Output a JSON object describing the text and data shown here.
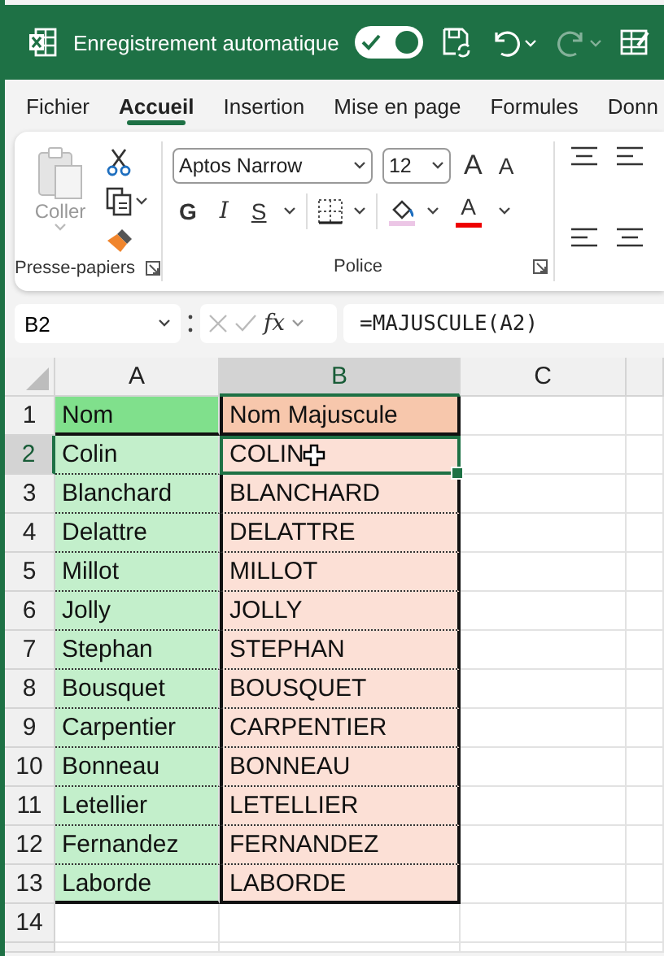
{
  "title_bar": {
    "title": "Enregistrement automatique",
    "autosave_on": true,
    "redo_disabled": true
  },
  "tabs": [
    {
      "label": "Fichier",
      "selected": false
    },
    {
      "label": "Accueil",
      "selected": true
    },
    {
      "label": "Insertion",
      "selected": false
    },
    {
      "label": "Mise en page",
      "selected": false
    },
    {
      "label": "Formules",
      "selected": false
    },
    {
      "label": "Donn",
      "selected": false
    }
  ],
  "ribbon": {
    "clipboard": {
      "label": "Presse-papiers",
      "paste_label": "Coller",
      "paste_disabled": true
    },
    "font": {
      "label": "Police",
      "font_name": "Aptos Narrow",
      "font_size": "12",
      "grow": "A",
      "shrink": "A",
      "bold": "G",
      "italic": "I",
      "underline": "S",
      "font_color": "A"
    }
  },
  "formula_bar": {
    "name_box": "B2",
    "fx": "fx",
    "formula": "=MAJUSCULE(A2)"
  },
  "sheet": {
    "columns": [
      {
        "label": "A",
        "selected": false
      },
      {
        "label": "B",
        "selected": true
      },
      {
        "label": "C",
        "selected": false
      }
    ],
    "rows": [
      {
        "number": "1",
        "selected": false,
        "cells": [
          {
            "text": "Nom",
            "color": "#80e08c",
            "selected": false
          },
          {
            "text": "Nom Majuscule",
            "color": "#f7c7ac",
            "selected": false
          }
        ]
      },
      {
        "number": "2",
        "selected": true,
        "cells": [
          {
            "text": "Colin",
            "color": "#c3efcb",
            "selected": false
          },
          {
            "text": "COLIN",
            "color": "#fce0d6",
            "selected": true
          }
        ]
      },
      {
        "number": "3",
        "selected": false,
        "cells": [
          {
            "text": "Blanchard",
            "color": "#c3efcb",
            "selected": false
          },
          {
            "text": "BLANCHARD",
            "color": "#fce0d6",
            "selected": false
          }
        ]
      },
      {
        "number": "4",
        "selected": false,
        "cells": [
          {
            "text": "Delattre",
            "color": "#c3efcb",
            "selected": false
          },
          {
            "text": "DELATTRE",
            "color": "#fce0d6",
            "selected": false
          }
        ]
      },
      {
        "number": "5",
        "selected": false,
        "cells": [
          {
            "text": "Millot",
            "color": "#c3efcb",
            "selected": false
          },
          {
            "text": "MILLOT",
            "color": "#fce0d6",
            "selected": false
          }
        ]
      },
      {
        "number": "6",
        "selected": false,
        "cells": [
          {
            "text": "Jolly",
            "color": "#c3efcb",
            "selected": false
          },
          {
            "text": "JOLLY",
            "color": "#fce0d6",
            "selected": false
          }
        ]
      },
      {
        "number": "7",
        "selected": false,
        "cells": [
          {
            "text": "Stephan",
            "color": "#c3efcb",
            "selected": false
          },
          {
            "text": "STEPHAN",
            "color": "#fce0d6",
            "selected": false
          }
        ]
      },
      {
        "number": "8",
        "selected": false,
        "cells": [
          {
            "text": "Bousquet",
            "color": "#c3efcb",
            "selected": false
          },
          {
            "text": "BOUSQUET",
            "color": "#fce0d6",
            "selected": false
          }
        ]
      },
      {
        "number": "9",
        "selected": false,
        "cells": [
          {
            "text": "Carpentier",
            "color": "#c3efcb",
            "selected": false
          },
          {
            "text": "CARPENTIER",
            "color": "#fce0d6",
            "selected": false
          }
        ]
      },
      {
        "number": "10",
        "selected": false,
        "cells": [
          {
            "text": "Bonneau",
            "color": "#c3efcb",
            "selected": false
          },
          {
            "text": "BONNEAU",
            "color": "#fce0d6",
            "selected": false
          }
        ]
      },
      {
        "number": "11",
        "selected": false,
        "cells": [
          {
            "text": "Letellier",
            "color": "#c3efcb",
            "selected": false
          },
          {
            "text": "LETELLIER",
            "color": "#fce0d6",
            "selected": false
          }
        ]
      },
      {
        "number": "12",
        "selected": false,
        "cells": [
          {
            "text": "Fernandez",
            "color": "#c3efcb",
            "selected": false
          },
          {
            "text": "FERNANDEZ",
            "color": "#fce0d6",
            "selected": false
          }
        ]
      },
      {
        "number": "13",
        "selected": false,
        "cells": [
          {
            "text": "Laborde",
            "color": "#c3efcb",
            "selected": false
          },
          {
            "text": "LABORDE",
            "color": "#fce0d6",
            "selected": false
          }
        ]
      },
      {
        "number": "14",
        "selected": false,
        "cells": []
      }
    ]
  }
}
